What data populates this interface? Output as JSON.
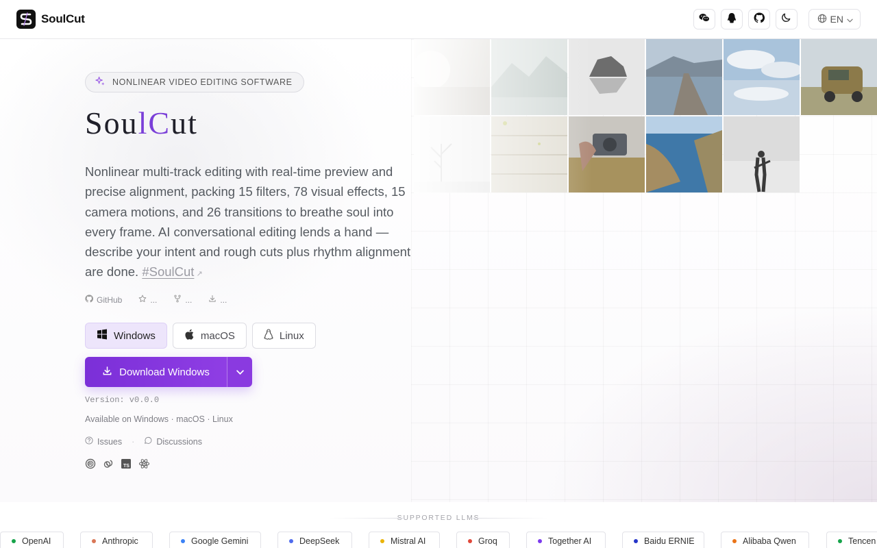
{
  "brand": {
    "name": "SoulCut"
  },
  "header": {
    "icons": [
      "wechat-icon",
      "qq-icon",
      "github-icon",
      "moon-icon"
    ],
    "language": "EN"
  },
  "hero": {
    "badge": "NONLINEAR VIDEO EDITING SOFTWARE",
    "title_parts": [
      "Sou",
      "lC",
      "ut"
    ],
    "description": "Nonlinear multi-track editing with real-time preview and precise alignment, packing 15 filters, 78 visual effects, 15 camera motions, and 26 transitions to breathe soul into every frame. AI conversational editing lends a hand — describe your intent and rough cuts plus rhythm alignment are done. ",
    "hashtag": "#SoulCut"
  },
  "stats": {
    "github": "GitHub",
    "stars": "...",
    "forks": "...",
    "downloads": "..."
  },
  "os_tabs": [
    {
      "label": "Windows",
      "active": true
    },
    {
      "label": "macOS",
      "active": false
    },
    {
      "label": "Linux",
      "active": false
    }
  ],
  "download": {
    "label": "Download Windows"
  },
  "version": "Version: v0.0.0",
  "available": "Available on Windows · macOS · Linux",
  "links": {
    "issues": "Issues",
    "separator": "·",
    "discussions": "Discussions"
  },
  "tech_icons": [
    "rust-icon",
    "tauri-icon",
    "typescript-icon",
    "react-icon"
  ],
  "llm": {
    "heading": "SUPPORTED LLMS",
    "providers": [
      {
        "name": "OpenAI",
        "color": "#16a34a"
      },
      {
        "name": "Anthropic",
        "color": "#d97757"
      },
      {
        "name": "Google Gemini",
        "color": "#3b82f6"
      },
      {
        "name": "DeepSeek",
        "color": "#4f6bed"
      },
      {
        "name": "Mistral AI",
        "color": "#eab308"
      },
      {
        "name": "Groq",
        "color": "#e0483a"
      },
      {
        "name": "Together AI",
        "color": "#7c3aed"
      },
      {
        "name": "Baidu ERNIE",
        "color": "#2535c9"
      },
      {
        "name": "Alibaba Qwen",
        "color": "#ea7418"
      },
      {
        "name": "Tencen",
        "color": "#16a34a"
      }
    ]
  }
}
